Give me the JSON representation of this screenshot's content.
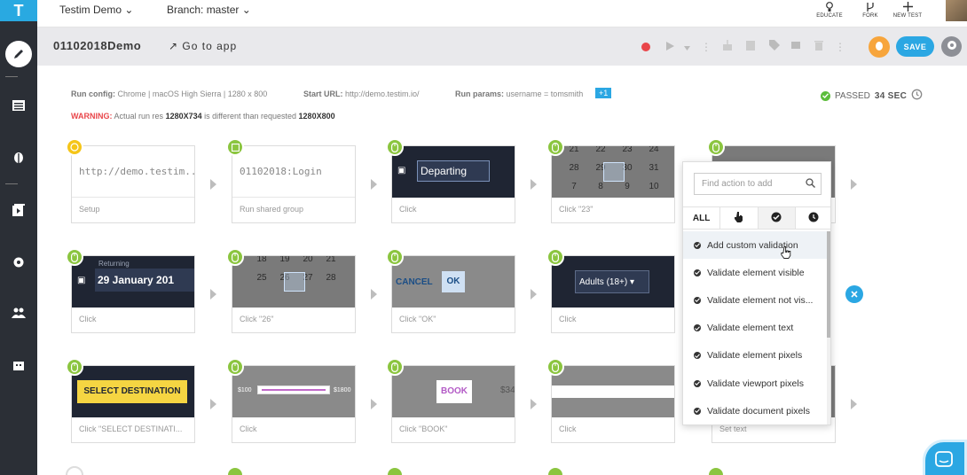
{
  "app": {
    "logo": "T"
  },
  "topbar": {
    "project": "Testim Demo",
    "branch": "Branch: master",
    "actions": [
      {
        "label": "EDUCATE",
        "icon": "lightbulb-icon"
      },
      {
        "label": "FORK",
        "icon": "fork-icon"
      },
      {
        "label": "NEW TEST",
        "icon": "plus-icon"
      }
    ]
  },
  "header": {
    "test_name": "01102018Demo",
    "goto_label": "Go to app",
    "save_label": "SAVE"
  },
  "run_info": {
    "config_label": "Run config:",
    "config_value": "Chrome | macOS High Sierra | 1280 x 800",
    "url_label": "Start URL:",
    "url_value": "http://demo.testim.io/",
    "params_label": "Run params:",
    "params_value": "username = tomsmith",
    "params_more": "+1",
    "warning_label": "WARNING:",
    "warning_text": "Actual run res",
    "warning_actual": "1280X734",
    "warning_mid": "is different than requested",
    "warning_requested": "1280X800",
    "status": "PASSED",
    "duration": "34 SEC"
  },
  "steps": {
    "row1": [
      {
        "caption": "Setup",
        "text": "http://demo.testim....",
        "badge": "yellow"
      },
      {
        "caption": "Run shared group",
        "text": "01102018:Login",
        "badge": "green"
      },
      {
        "caption": "Click",
        "thumb_label": "Departing",
        "badge": "green"
      },
      {
        "caption": "Click \"23\"",
        "badge": "green",
        "cal": [
          "21",
          "22",
          "23",
          "24",
          "28",
          "29",
          "30",
          "31",
          "7",
          "8",
          "9",
          "10"
        ]
      },
      {
        "caption": "",
        "badge": "green"
      }
    ],
    "row2": [
      {
        "caption": "Click",
        "thumb_small": "Returning",
        "thumb_label": "29 January 201",
        "badge": "green"
      },
      {
        "caption": "Click \"26\"",
        "badge": "green",
        "cal": [
          "18",
          "19",
          "20",
          "21",
          "25",
          "26",
          "27",
          "28"
        ]
      },
      {
        "caption": "Click \"OK\"",
        "cancel": "CANCEL",
        "ok": "OK",
        "badge": "green"
      },
      {
        "caption": "Click",
        "thumb_label": "Adults (18+)",
        "badge": "green"
      }
    ],
    "row3": [
      {
        "caption": "Click \"SELECT DESTINATI...",
        "thumb_label": "SELECT DESTINATION",
        "badge": "green"
      },
      {
        "caption": "Click",
        "min": "$100",
        "max": "$1800",
        "badge": "green"
      },
      {
        "caption": "Click \"BOOK\"",
        "thumb_label": "BOOK",
        "side": "$34",
        "badge": "green"
      },
      {
        "caption": "Click",
        "badge": "green"
      },
      {
        "caption": "Set text",
        "badge": "green"
      }
    ]
  },
  "dropdown": {
    "search_placeholder": "Find action to add",
    "tabs": [
      {
        "label": "ALL",
        "icon": ""
      },
      {
        "label": "",
        "icon": "hand-pointer-icon"
      },
      {
        "label": "",
        "icon": "check-circle-icon"
      },
      {
        "label": "",
        "icon": "clock-icon"
      }
    ],
    "items": [
      "Add custom validation",
      "Validate element visible",
      "Validate element not vis...",
      "Validate element text",
      "Validate element pixels",
      "Validate viewport pixels",
      "Validate document pixels"
    ]
  },
  "colors": {
    "accent": "#2ba7e3",
    "sidebar": "#2b2f36",
    "success": "#5cbd3c",
    "badge_green": "#8bc53f",
    "badge_yellow": "#f5c518",
    "record": "#e9464a",
    "bug": "#f7a53c"
  }
}
